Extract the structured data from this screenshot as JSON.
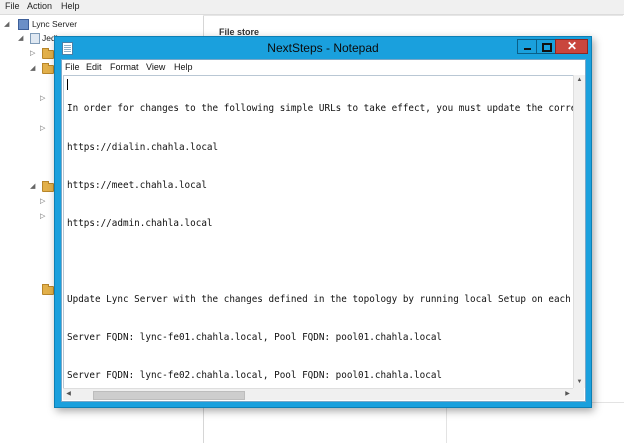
{
  "background_app": {
    "menu": [
      "File",
      "Action",
      "Help"
    ],
    "tree": {
      "root_label": "Lync Server",
      "child_label": "Jedi"
    },
    "right_pane": {
      "header": "File store"
    }
  },
  "notepad": {
    "title": "NextSteps - Notepad",
    "menu": [
      "File",
      "Edit",
      "Format",
      "View",
      "Help"
    ],
    "lines": [
      "In order for changes to the following simple URLs to take effect, you must update the corre",
      "https://dialin.chahla.local",
      "https://meet.chahla.local",
      "https://admin.chahla.local",
      "",
      "Update Lync Server with the changes defined in the topology by running local Setup on each",
      "Server FQDN: lync-fe01.chahla.local, Pool FQDN: pool01.chahla.local",
      "Server FQDN: lync-fe02.chahla.local, Pool FQDN: pool01.chahla.local"
    ],
    "scrollbar": {
      "horizontal_position": 0.05
    },
    "colors": {
      "title_bar": "#1aa0dd",
      "close_button": "#c9463d"
    }
  }
}
